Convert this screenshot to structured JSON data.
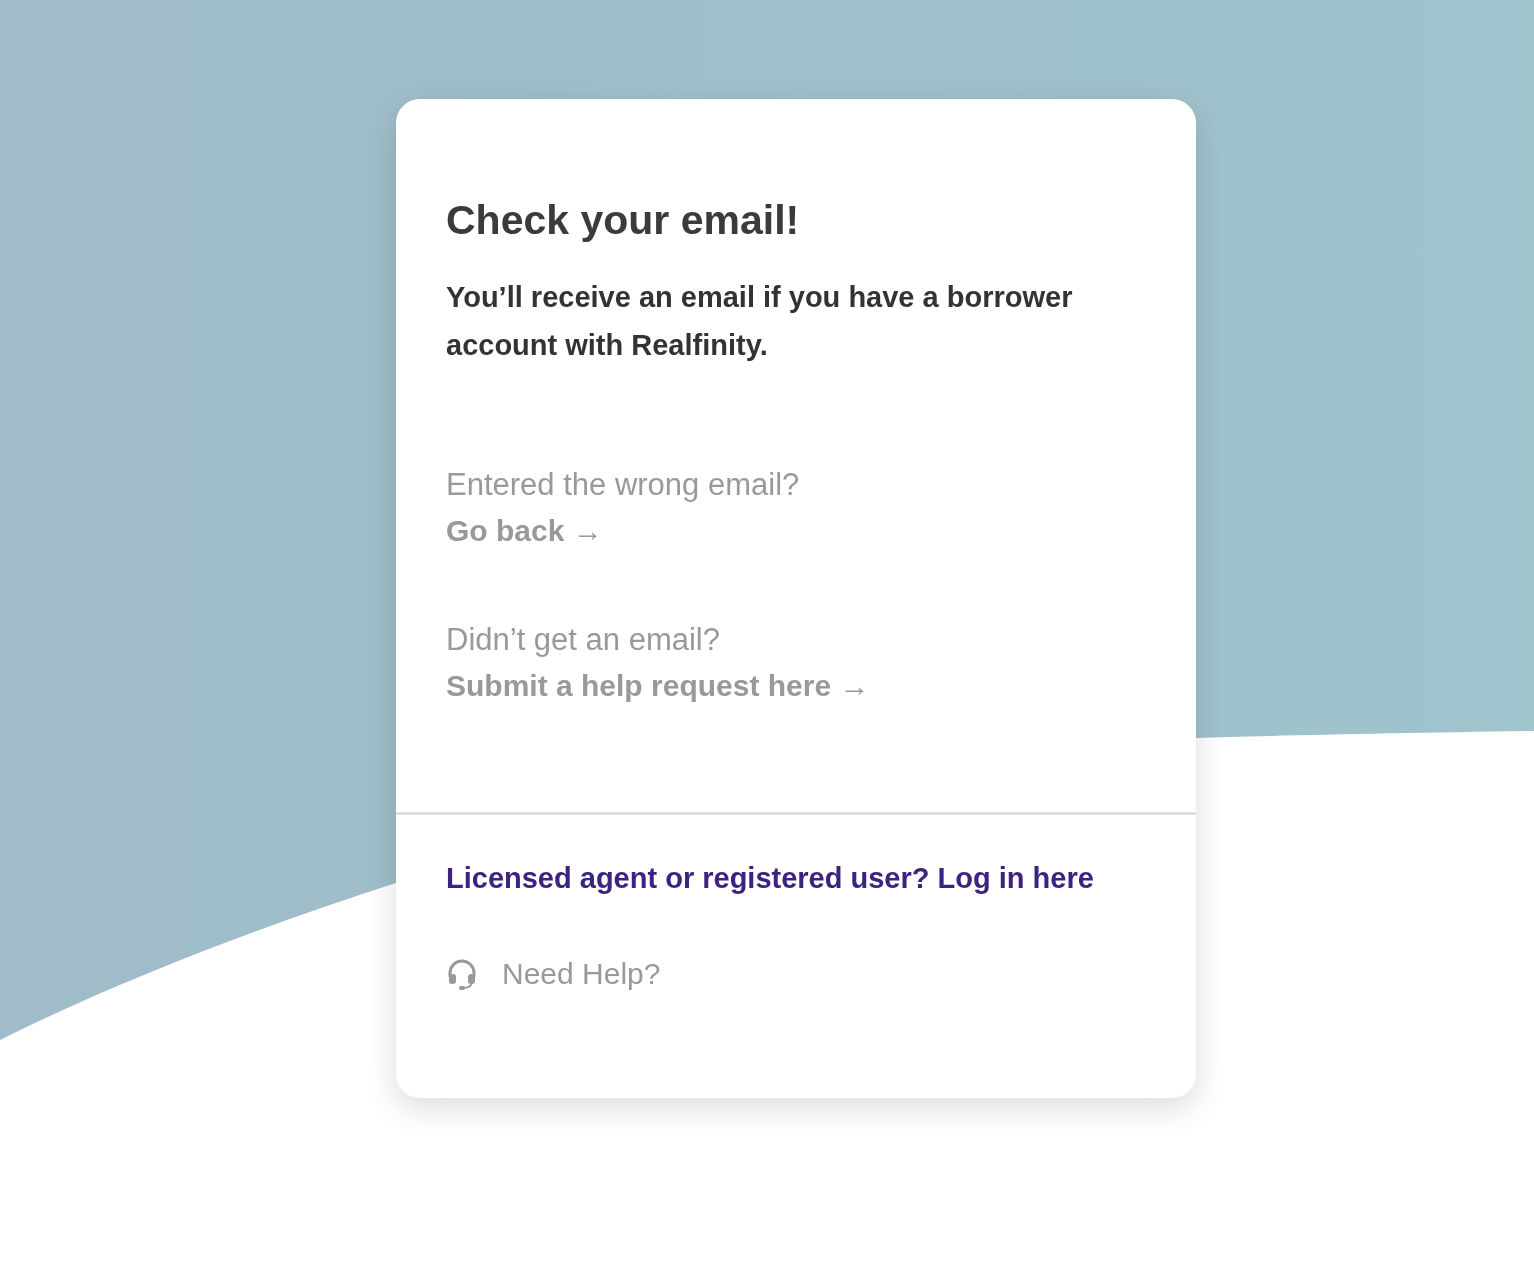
{
  "title": "Check your email!",
  "message": "You’ll receive an email if you have a borrower account with Realfinity.",
  "prompts": [
    {
      "question": "Entered the wrong email?",
      "link": "Go back →"
    },
    {
      "question": "Didn’t get an email?",
      "link": "Submit a help request here →"
    }
  ],
  "login_link": "Licensed agent or registered user? Log in here",
  "help": {
    "label": "Need Help?"
  }
}
